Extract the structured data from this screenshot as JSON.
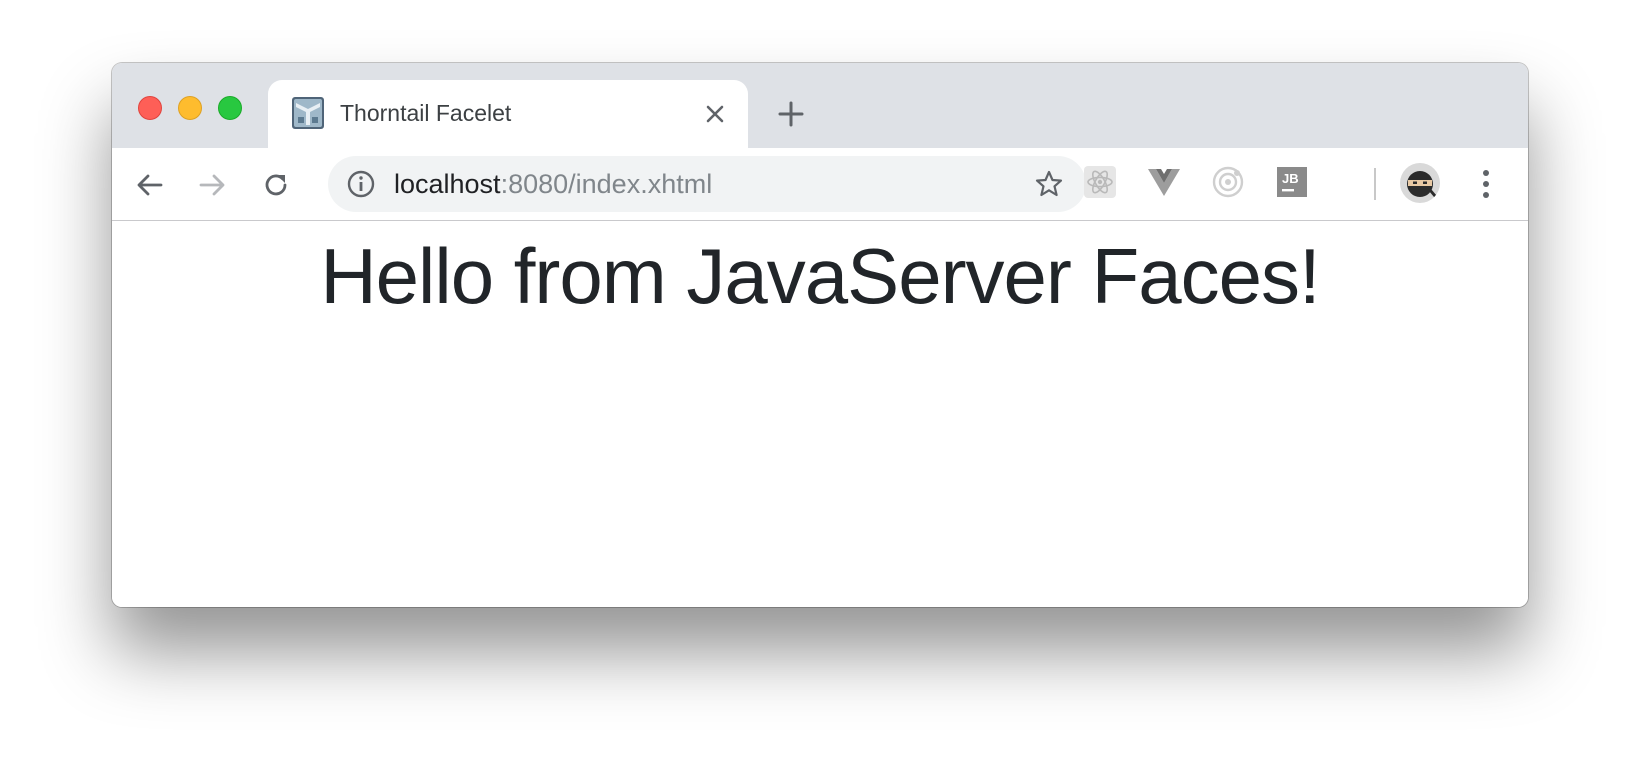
{
  "browser": {
    "tab": {
      "title": "Thorntail Facelet",
      "favicon": "thorntail-favicon"
    },
    "address_bar": {
      "host": "localhost",
      "rest": ":8080/index.xhtml"
    },
    "icons": {
      "back": "arrow-left-icon",
      "forward": "arrow-right-icon",
      "reload": "reload-icon",
      "info": "info-icon",
      "bookmark": "star-icon",
      "extensions": [
        "react-devtools-icon",
        "vue-devtools-icon",
        "extension-target-icon",
        "jetbrains-icon"
      ],
      "profile": "ninja-avatar",
      "menu": "kebab-menu-icon"
    },
    "colors": {
      "tabbar": "#dee1e6",
      "omnibox": "#f1f3f4",
      "close": "#fe5f57",
      "minimize": "#febc2e",
      "maximize": "#28c840"
    }
  },
  "page": {
    "heading": "Hello from JavaServer Faces!"
  }
}
